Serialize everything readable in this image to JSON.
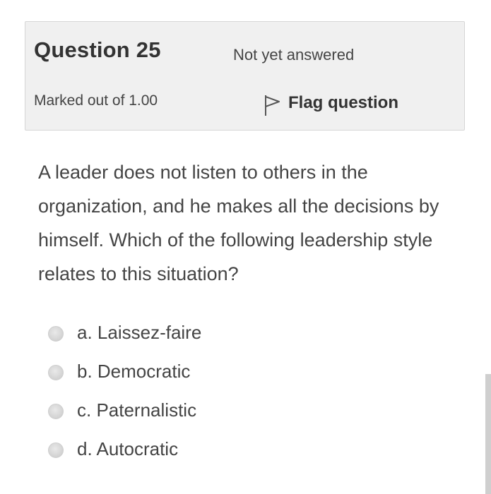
{
  "question": {
    "prefix": "Question",
    "number": "25",
    "state": "Not yet answered",
    "grade": "Marked out of 1.00",
    "flag_label": "Flag question",
    "text": "A leader does not listen to others in the organization, and he makes all the decisions by himself. Which of the following leadership style relates to this situation?"
  },
  "answers": [
    {
      "label": "a. Laissez-faire",
      "selected": false
    },
    {
      "label": "b. Democratic",
      "selected": false
    },
    {
      "label": "c. Paternalistic",
      "selected": false
    },
    {
      "label": "d. Autocratic",
      "selected": false
    }
  ],
  "icons": {
    "flag": "flag-outline-icon",
    "radio": "radio-unchecked"
  },
  "colors": {
    "info_background": "#f0f0f0",
    "text": "#444444"
  }
}
